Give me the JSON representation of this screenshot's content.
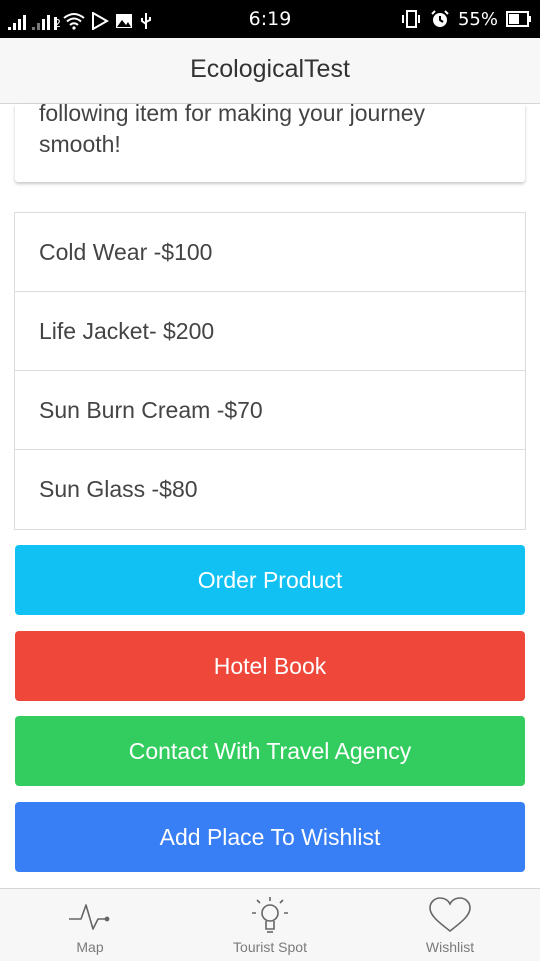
{
  "status_bar": {
    "time": "6:19",
    "battery": "55%",
    "sim_slot": "2"
  },
  "header": {
    "title": "EcologicalTest"
  },
  "card": {
    "text": "following item for making your journey smooth!"
  },
  "items": [
    {
      "label": "Cold Wear -$100"
    },
    {
      "label": "Life Jacket- $200"
    },
    {
      "label": "Sun Burn Cream -$70"
    },
    {
      "label": "Sun Glass -$80"
    }
  ],
  "buttons": {
    "order": {
      "label": "Order Product",
      "color": "#11c1f3"
    },
    "hotel": {
      "label": "Hotel Book",
      "color": "#ef473a"
    },
    "agency": {
      "label": "Contact With Travel Agency",
      "color": "#33cd5f"
    },
    "wishlist": {
      "label": "Add Place To Wishlist",
      "color": "#387ef5"
    }
  },
  "tabs": [
    {
      "label": "Map",
      "icon": "pulse-icon"
    },
    {
      "label": "Tourist Spot",
      "icon": "lightbulb-icon"
    },
    {
      "label": "Wishlist",
      "icon": "heart-icon"
    }
  ]
}
